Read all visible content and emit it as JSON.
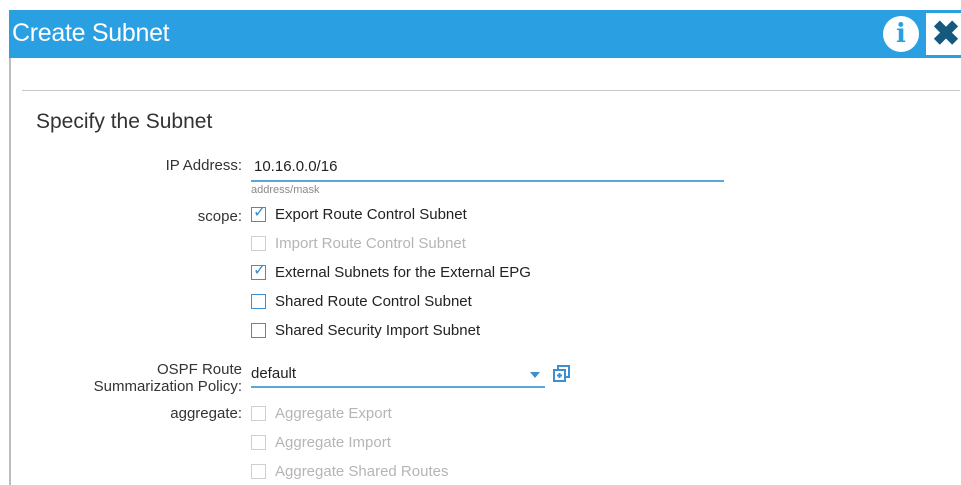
{
  "dialog": {
    "title": "Create Subnet",
    "info_icon": "info-icon",
    "close_icon": "close-icon"
  },
  "form": {
    "section_title": "Specify the Subnet",
    "ip": {
      "label": "IP Address:",
      "value": "10.16.0.0/16",
      "hint": "address/mask"
    },
    "scope": {
      "label": "scope:",
      "options": [
        {
          "label": "Export Route Control Subnet",
          "checked": true,
          "disabled": false
        },
        {
          "label": "Import Route Control Subnet",
          "checked": false,
          "disabled": true
        },
        {
          "label": "External Subnets for the External EPG",
          "checked": true,
          "disabled": false
        },
        {
          "label": "Shared Route Control Subnet",
          "checked": false,
          "disabled": false
        },
        {
          "label": "Shared Security Import Subnet",
          "checked": false,
          "disabled": false
        }
      ]
    },
    "ospf": {
      "label_line1": "OSPF Route",
      "label_line2": "Summarization Policy:",
      "value": "default",
      "dropdown_icon": "caret-down-icon",
      "action_icon": "new-window-icon"
    },
    "aggregate": {
      "label": "aggregate:",
      "options": [
        {
          "label": "Aggregate Export",
          "checked": false,
          "disabled": true
        },
        {
          "label": "Aggregate Import",
          "checked": false,
          "disabled": true
        },
        {
          "label": "Aggregate Shared Routes",
          "checked": false,
          "disabled": true
        }
      ]
    }
  },
  "colors": {
    "header": "#2aa0e2",
    "accent": "#3c8fd0",
    "close_icon": "#16597e"
  }
}
